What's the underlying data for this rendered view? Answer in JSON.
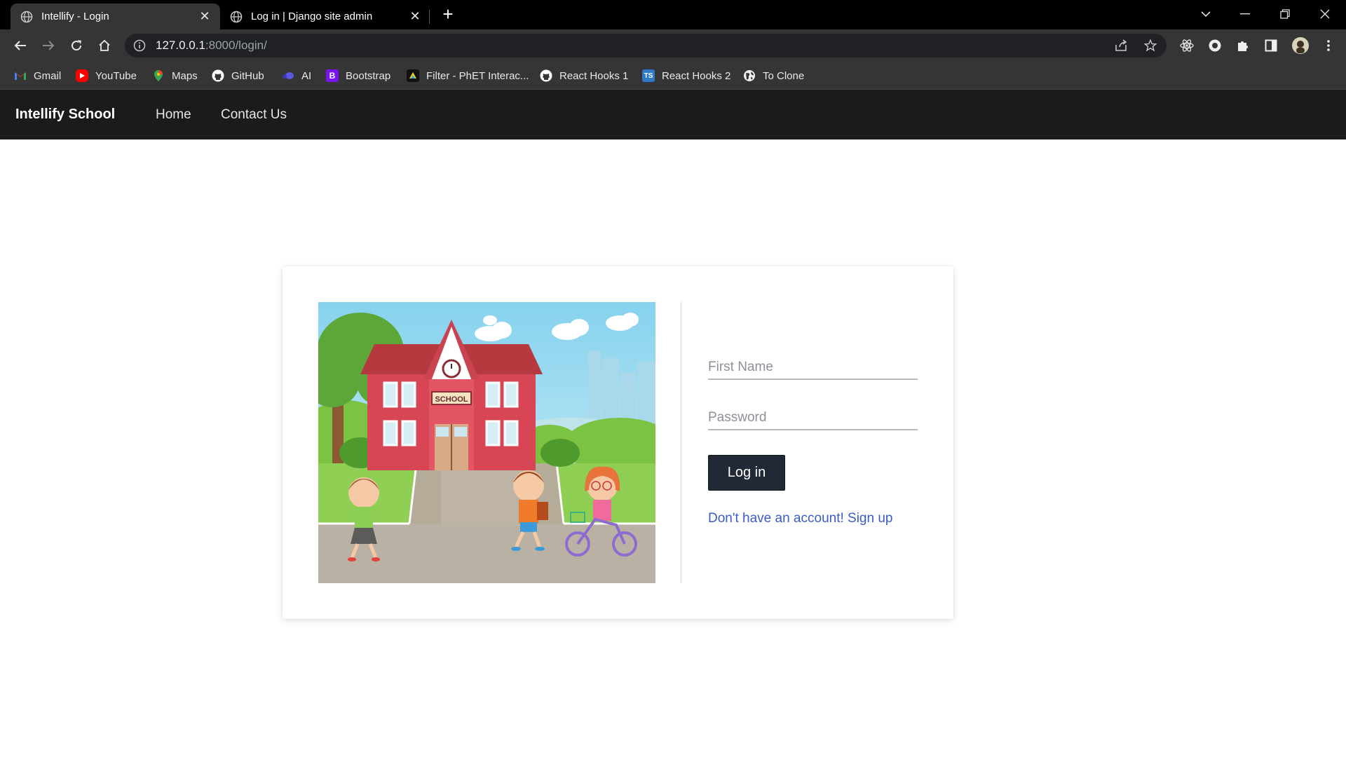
{
  "browser": {
    "tabs": [
      {
        "title": "Intellify - Login",
        "active": true
      },
      {
        "title": "Log in | Django site admin",
        "active": false
      }
    ],
    "url": {
      "host": "127.0.0.1",
      "rest": ":8000/login/"
    },
    "bookmarks": [
      {
        "label": "Gmail",
        "icon": "gmail-icon"
      },
      {
        "label": "YouTube",
        "icon": "youtube-icon"
      },
      {
        "label": "Maps",
        "icon": "maps-icon"
      },
      {
        "label": "GitHub",
        "icon": "github-icon"
      },
      {
        "label": "AI",
        "icon": "ai-icon"
      },
      {
        "label": "Bootstrap",
        "icon": "bootstrap-icon",
        "glyph": "B"
      },
      {
        "label": "Filter - PhET Interac...",
        "icon": "phet-icon"
      },
      {
        "label": "React Hooks 1",
        "icon": "github-icon"
      },
      {
        "label": "React Hooks 2",
        "icon": "typescript-icon",
        "glyph": "TS"
      },
      {
        "label": "To Clone",
        "icon": "globe-icon"
      }
    ]
  },
  "site": {
    "brand": "Intellify School",
    "nav": [
      "Home",
      "Contact Us"
    ]
  },
  "login": {
    "illustration": {
      "sign_text": "SCHOOL"
    },
    "first_name_placeholder": "First Name",
    "password_placeholder": "Password",
    "submit_label": "Log in",
    "signup_link": "Don't have an account! Sign up"
  },
  "colors": {
    "navbar": "#1b1b1b",
    "button": "#212936",
    "link": "#3b5bc4"
  }
}
